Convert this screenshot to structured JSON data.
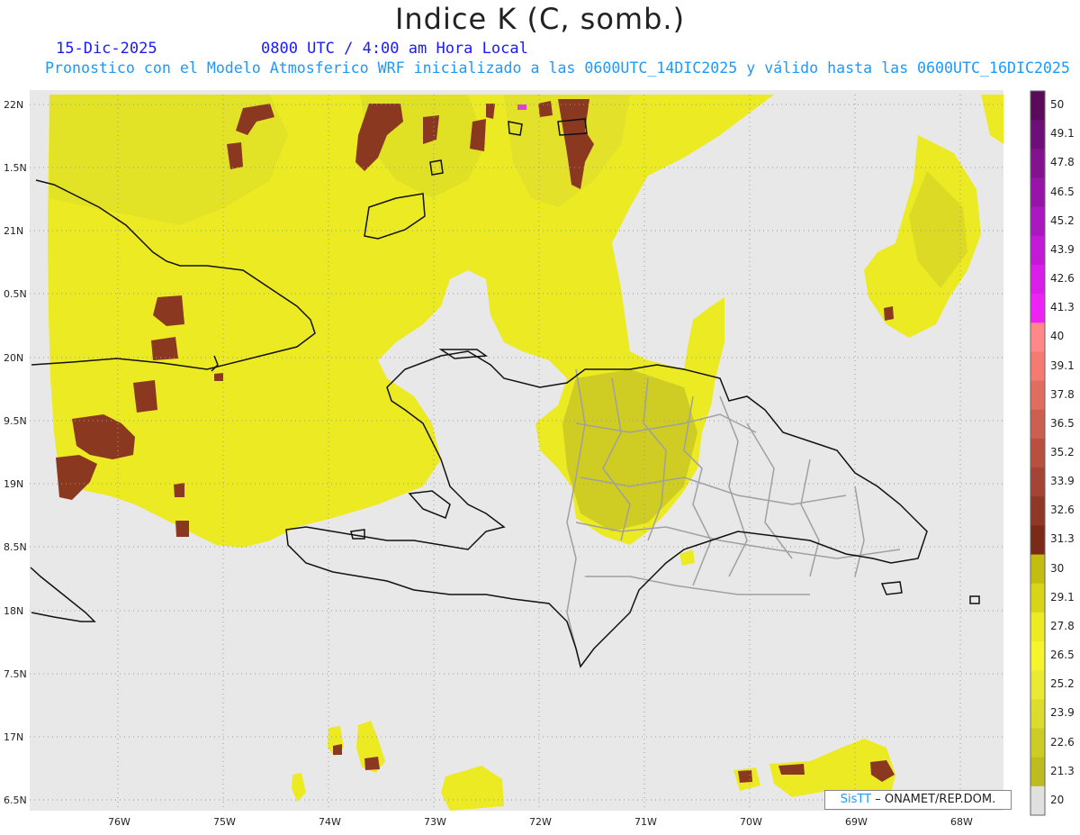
{
  "header": {
    "title": "Indice K (C, somb.)",
    "date": "15-Dic-2025",
    "time": "0800 UTC / 4:00 am Hora Local",
    "forecast": "Pronostico con el Modelo Atmosferico WRF inicializado a las 0600UTC_14DIC2025 y válido hasta las  0600UTC_16DIC2025"
  },
  "map": {
    "lat_labels": [
      "22N",
      "1.5N",
      "21N",
      "0.5N",
      "20N",
      "9.5N",
      "19N",
      "8.5N",
      "18N",
      "7.5N",
      "17N",
      "6.5N"
    ],
    "lon_labels": [
      "76W",
      "75W",
      "74W",
      "73W",
      "72W",
      "71W",
      "70W",
      "69W",
      "68W"
    ]
  },
  "colorbar": {
    "labels": [
      "50",
      "49.1",
      "47.8",
      "46.5",
      "45.2",
      "43.9",
      "42.6",
      "41.3",
      "40",
      "39.1",
      "37.8",
      "36.5",
      "35.2",
      "33.9",
      "32.6",
      "31.3",
      "30",
      "29.1",
      "27.8",
      "26.5",
      "25.2",
      "23.9",
      "22.6",
      "21.3",
      "20"
    ],
    "colors": [
      "#5a0a5a",
      "#6e0e78",
      "#82128e",
      "#9614a8",
      "#aa18c0",
      "#c21ad6",
      "#d81ee8",
      "#ee22f6",
      "#ff8888",
      "#f47a72",
      "#e06e60",
      "#cc6050",
      "#b85040",
      "#a44434",
      "#903828",
      "#7c2a18",
      "#c2bd10",
      "#d8d418",
      "#ecea22",
      "#f6f42c",
      "#eaea34",
      "#dcdc2e",
      "#cccc26",
      "#bcbc1e",
      "#e0e0e0"
    ]
  },
  "credit": {
    "sis": "SisTT",
    "org": "– ONAMET/REP.DOM."
  }
}
